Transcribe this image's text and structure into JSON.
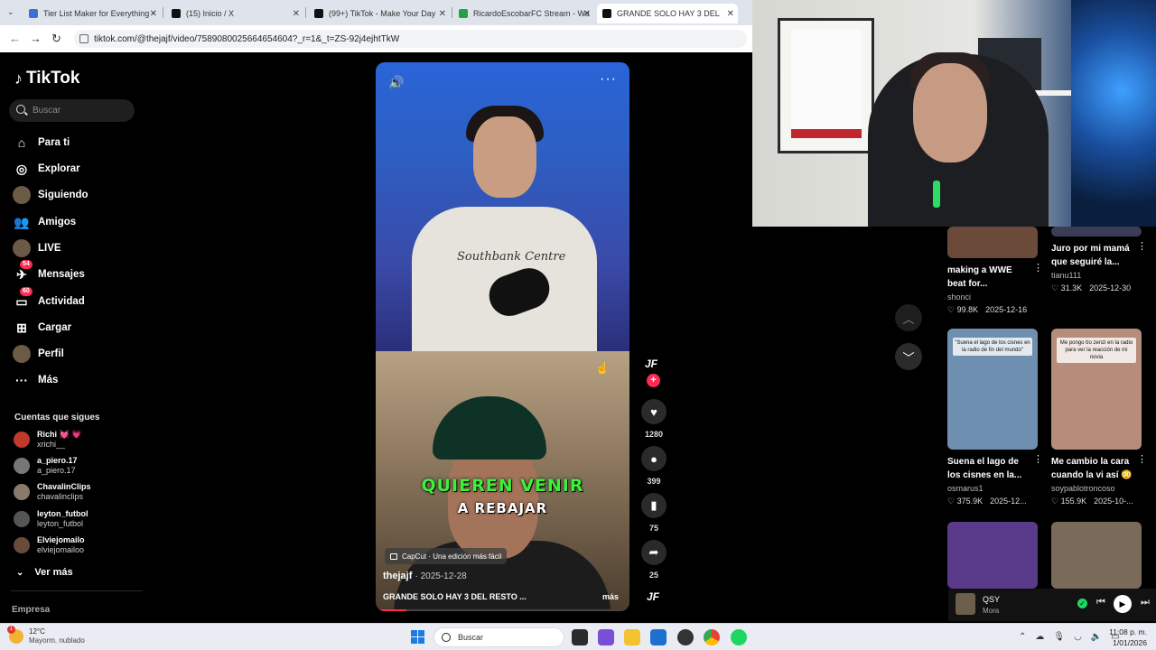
{
  "browser": {
    "tabs": [
      {
        "title": "Tier List Maker for Everything -",
        "color": "#3b6fd6"
      },
      {
        "title": "(15) Inicio / X",
        "color": "#111111"
      },
      {
        "title": "(99+) TikTok - Make Your Day",
        "color": "#111111"
      },
      {
        "title": "RicardoEscobarFC Stream - Wa",
        "color": "#1ea446"
      },
      {
        "title": "GRANDE SOLO HAY 3 DEL",
        "color": "#111111"
      }
    ],
    "url": "tiktok.com/@thejajf/video/7589080025664654604?_r=1&_t=ZS-92j4ejhtTkW"
  },
  "sidebar": {
    "logo": "TikTok",
    "search_placeholder": "Buscar",
    "nav": [
      {
        "label": "Para ti",
        "icon": "home-icon",
        "glyph": "⌂"
      },
      {
        "label": "Explorar",
        "icon": "compass-icon",
        "glyph": "◎"
      },
      {
        "label": "Siguiendo",
        "icon": "following-icon",
        "glyph": ""
      },
      {
        "label": "Amigos",
        "icon": "friends-icon",
        "glyph": "👥"
      },
      {
        "label": "LIVE",
        "icon": "live-icon",
        "glyph": ""
      },
      {
        "label": "Mensajes",
        "icon": "messages-icon",
        "glyph": "✈",
        "badge": "54"
      },
      {
        "label": "Actividad",
        "icon": "activity-icon",
        "glyph": "▭",
        "badge": "60"
      },
      {
        "label": "Cargar",
        "icon": "upload-icon",
        "glyph": "⊞"
      },
      {
        "label": "Perfil",
        "icon": "profile-icon",
        "glyph": ""
      },
      {
        "label": "Más",
        "icon": "more-dots-icon",
        "glyph": "···"
      }
    ],
    "following_header": "Cuentas que sigues",
    "following": [
      {
        "name": "Richi 💓 💗",
        "handle": "xrichi__",
        "color": "#c0392b"
      },
      {
        "name": "a_piero.17",
        "handle": "a_piero.17",
        "color": "#777777"
      },
      {
        "name": "ChavalinClips",
        "handle": "chavalinclips",
        "color": "#8a7a6a"
      },
      {
        "name": "leyton_futbol",
        "handle": "leyton_futbol",
        "color": "#555555"
      },
      {
        "name": "Elviejomailo",
        "handle": "elviejomailoo",
        "color": "#6a4a3a"
      }
    ],
    "see_more": "Ver más",
    "company": "Empresa"
  },
  "video": {
    "shirt_text": "Southbank Centre",
    "caption_line1": "QUIEREN VENIR",
    "caption_line2": "A REBAJAR",
    "capcut_label": "CapCut · Una edición más fácil",
    "author": "thejajf",
    "date": "· 2025-12-28",
    "description": "GRANDE SOLO HAY 3 DEL RESTO ...",
    "more": "más",
    "progress": 0.12
  },
  "actions": {
    "creator_mark": "JF",
    "likes": "1280",
    "comments": "399",
    "saves": "75",
    "shares": "25"
  },
  "recommendations": [
    {
      "title1": "making a WWE",
      "title2": "beat for...",
      "author": "shonci",
      "likes": "99.8K",
      "date": "2025-12-16",
      "thumb": "#6b4a3a"
    },
    {
      "title1": "Juro por mi mamá",
      "title2": "que seguiré la...",
      "author": "tianu111",
      "likes": "31.3K",
      "date": "2025-12-30",
      "thumb": "#3a3d55"
    },
    {
      "title1": "Suena el lago de",
      "title2": "los cisnes en la...",
      "author": "osmarus1",
      "likes": "375.9K",
      "date": "2025-12...",
      "thumb": "#6f8fb0",
      "overlay": "\"Suena el lago de los cisnes en la radio de fin del mundo\""
    },
    {
      "title1": "Me cambio la cara",
      "title2": "cuando la vi así 😳",
      "author": "soypablotroncoso",
      "likes": "155.9K",
      "date": "2025-10-...",
      "thumb": "#b58d7a",
      "overlay": "Me pongo tío zenzi en la radio para ver la reacción de mi novia"
    },
    {
      "thumb": "#5a3a8a"
    },
    {
      "thumb": "#7a6a5a"
    }
  ],
  "player": {
    "song": "QSY",
    "artist": "Mora"
  },
  "taskbar": {
    "temp": "12°C",
    "condition": "Mayorm. nublado",
    "weather_badge": "1",
    "search": "Buscar",
    "time": "11:08 p. m.",
    "date": "1/01/2026"
  }
}
